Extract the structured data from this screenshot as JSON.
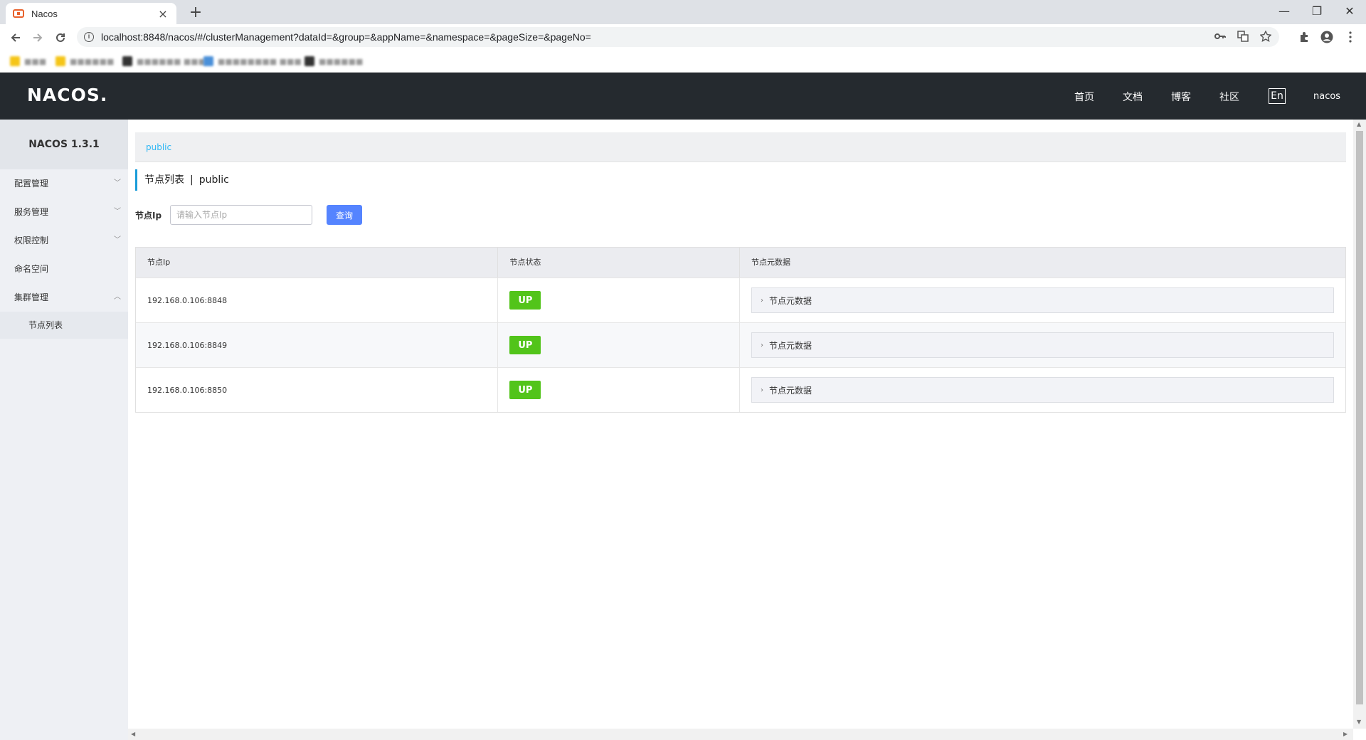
{
  "browser": {
    "tab_title": "Nacos",
    "new_tab": "+",
    "close_tab": "×",
    "url": "localhost:8848/nacos/#/clusterManagement?dataId=&group=&appName=&namespace=&pageSize=&pageNo=",
    "window_controls": {
      "minimize": "—",
      "restore": "❐",
      "close": "✕"
    },
    "bookmarks": [
      {
        "label": "■■■",
        "color": "#f5c518"
      },
      {
        "label": "■■■■■■",
        "color": "#f5c518"
      },
      {
        "label": "■■■■■■ ■■■",
        "color": "#333333"
      },
      {
        "label": "■■■■■■■■ ■■■",
        "color": "#4a90d9"
      },
      {
        "label": "■■■■■■",
        "color": "#333333"
      }
    ]
  },
  "header": {
    "logo": "NACOS.",
    "nav": [
      "首页",
      "文档",
      "博客",
      "社区"
    ],
    "lang": "En",
    "user": "nacos"
  },
  "sidebar": {
    "version": "NACOS 1.3.1",
    "items": [
      {
        "label": "配置管理",
        "arrow": "﹀"
      },
      {
        "label": "服务管理",
        "arrow": "﹀"
      },
      {
        "label": "权限控制",
        "arrow": "﹀"
      },
      {
        "label": "命名空间",
        "arrow": ""
      },
      {
        "label": "集群管理",
        "arrow": "︿"
      }
    ],
    "sub_items": [
      "节点列表"
    ]
  },
  "main": {
    "namespace": "public",
    "title": "节点列表",
    "title_sep": "|",
    "title_ns": "public",
    "search_label": "节点Ip",
    "search_placeholder": "请输入节点Ip",
    "search_button": "查询",
    "columns": [
      "节点Ip",
      "节点状态",
      "节点元数据"
    ],
    "rows": [
      {
        "ip": "192.168.0.106:8848",
        "status": "UP",
        "meta": "节点元数据"
      },
      {
        "ip": "192.168.0.106:8849",
        "status": "UP",
        "meta": "节点元数据"
      },
      {
        "ip": "192.168.0.106:8850",
        "status": "UP",
        "meta": "节点元数据"
      }
    ]
  },
  "colors": {
    "header_bg": "#252a2f",
    "primary_button": "#5584ff",
    "status_up": "#52c41a",
    "link": "#2db7f5",
    "title_accent": "#1a9cd9"
  }
}
